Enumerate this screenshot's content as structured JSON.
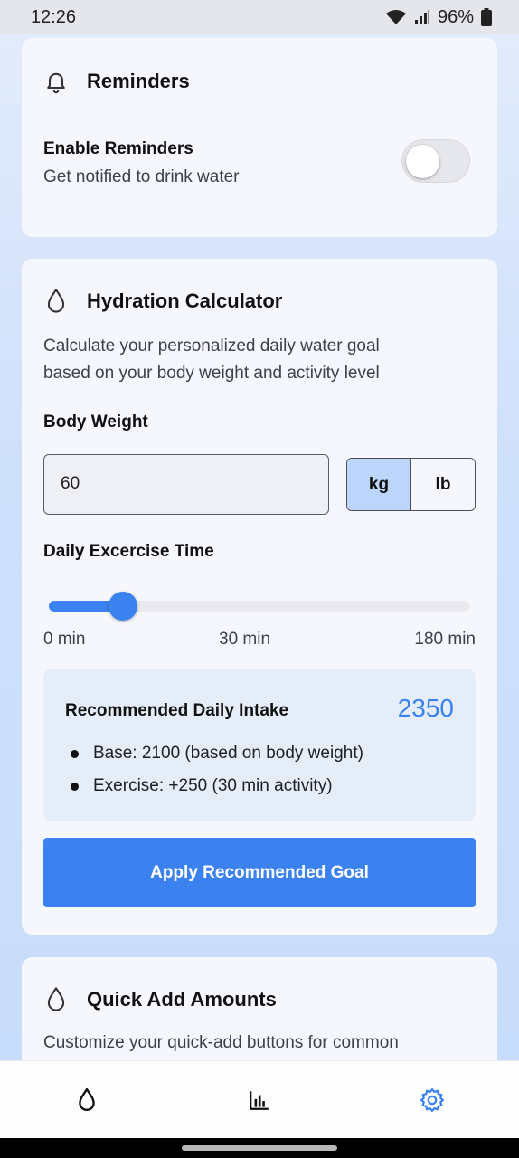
{
  "status_bar": {
    "time": "12:26",
    "battery": "96%"
  },
  "reminders": {
    "title": "Reminders",
    "enable_label": "Enable Reminders",
    "enable_desc": "Get notified to drink water",
    "enabled": false
  },
  "calculator": {
    "title": "Hydration Calculator",
    "description_line1": "Calculate your personalized daily water goal",
    "description_line2": "based on your body weight and activity level",
    "weight_label": "Body Weight",
    "weight_value": "60",
    "units": [
      "kg",
      "lb"
    ],
    "selected_unit": "kg",
    "exercise_label": "Daily Excercise Time",
    "exercise_fraction": 0.175,
    "tick_labels": [
      "0 min",
      "30 min",
      "180 min"
    ],
    "recommended_title": "Recommended Daily Intake",
    "recommended_value": "2350",
    "bullets": [
      "Base: 2100 (based on body weight)",
      "Exercise: +250 (30 min activity)"
    ],
    "apply_label": "Apply Recommended Goal"
  },
  "quick_add": {
    "title": "Quick Add Amounts",
    "description": "Customize your quick-add buttons for common"
  },
  "nav": {
    "items": [
      "water-drop-icon",
      "bar-chart-icon",
      "settings-gear-icon"
    ],
    "active": "settings-gear-icon",
    "accent": "#3b82f0"
  }
}
